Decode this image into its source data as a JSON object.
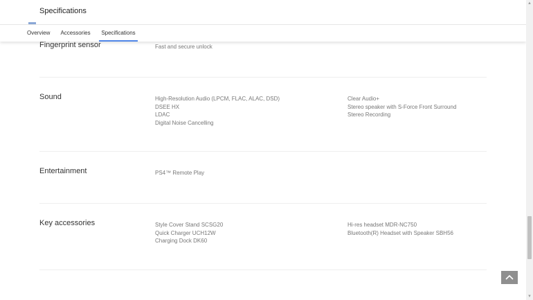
{
  "header": {
    "title": "Specifications",
    "tabs": [
      {
        "label": "Overview",
        "active": false
      },
      {
        "label": "Accessories",
        "active": false
      },
      {
        "label": "Specifications",
        "active": true
      }
    ]
  },
  "colors": {
    "accent": "#4f86e8",
    "back_to_top": "#8f8f8f",
    "text_primary": "#333333",
    "text_secondary": "#777777"
  },
  "sections": [
    {
      "title": "Fingerprint sensor",
      "left": [
        "Fast and secure unlock"
      ],
      "right": []
    },
    {
      "title": "Sound",
      "left": [
        "High-Resolution Audio (LPCM, FLAC, ALAC, DSD)",
        "DSEE HX",
        "LDAC",
        "Digital Noise Cancelling"
      ],
      "right": [
        "Clear Audio+",
        "Stereo speaker with S-Force Front Surround",
        "Stereo Recording"
      ]
    },
    {
      "title": "Entertainment",
      "left": [
        "PS4™ Remote Play"
      ],
      "right": []
    },
    {
      "title": "Key accessories",
      "left": [
        "Style Cover Stand SCSG20",
        "Quick Charger UCH12W",
        "Charging Dock DK60"
      ],
      "right": [
        "Hi-res headset MDR-NC750",
        "Bluetooth(R) Headset with Speaker SBH56"
      ]
    }
  ],
  "back_to_top": {
    "icon": "chevron-up-icon"
  }
}
